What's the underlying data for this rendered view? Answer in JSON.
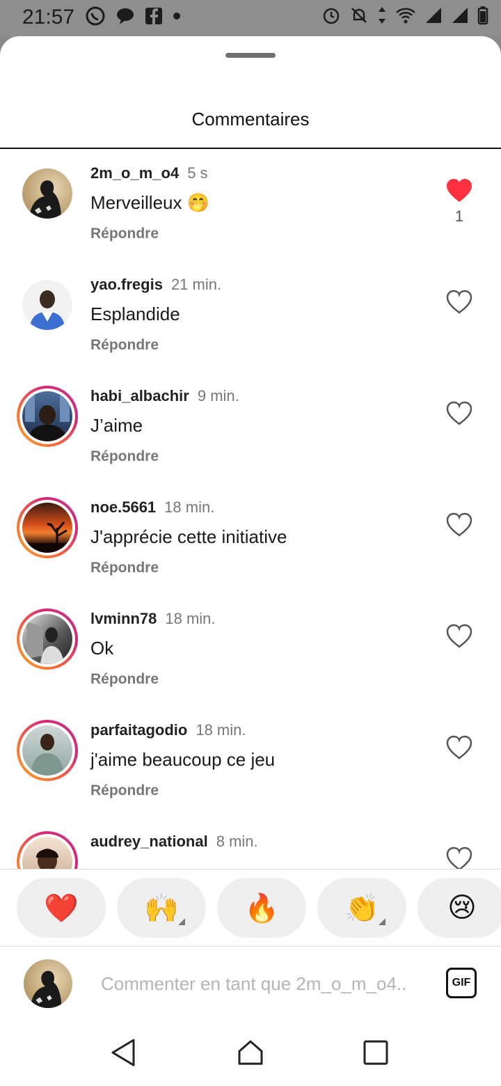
{
  "status_bar": {
    "time": "21:57",
    "left_icons": [
      "whatsapp-icon",
      "chat-bubble-icon",
      "facebook-icon",
      "dot-icon"
    ],
    "right_icons": [
      "alarm-icon",
      "bell-off-icon",
      "data-arrows-icon",
      "wifi-icon",
      "signal-icon",
      "signal-icon",
      "battery-icon"
    ]
  },
  "sheet": {
    "title": "Commentaires"
  },
  "comments": [
    {
      "username": "2m_o_m_o4",
      "time": "5 s",
      "text": "Merveilleux 🤭",
      "reply": "Répondre",
      "liked": true,
      "likes": "1",
      "story": false
    },
    {
      "username": "yao.fregis",
      "time": "21 min.",
      "text": "Esplandide",
      "reply": "Répondre",
      "liked": false,
      "story": false
    },
    {
      "username": "habi_albachir",
      "time": "9 min.",
      "text": "J’aime",
      "reply": "Répondre",
      "liked": false,
      "story": true
    },
    {
      "username": "noe.5661",
      "time": "18 min.",
      "text": "J'apprécie cette initiative",
      "reply": "Répondre",
      "liked": false,
      "story": true
    },
    {
      "username": "lvminn78",
      "time": "18 min.",
      "text": "Ok",
      "reply": "Répondre",
      "liked": false,
      "story": true
    },
    {
      "username": "parfaitagodio",
      "time": "18 min.",
      "text": "j'aime beaucoup ce jeu",
      "reply": "Répondre",
      "liked": false,
      "story": true
    },
    {
      "username": "audrey_national",
      "time": "8 min.",
      "text": "",
      "reply": "",
      "liked": false,
      "story": true
    }
  ],
  "reactions": [
    "❤️",
    "🙌",
    "🔥",
    "👏",
    "😢"
  ],
  "input": {
    "placeholder": "Commenter en tant que 2m_o_m_o4..",
    "gif_label": "GIF"
  },
  "colors": {
    "like_red": "#ff3040",
    "story_ring_start": "#f9a825",
    "story_ring_end": "#c13584"
  }
}
